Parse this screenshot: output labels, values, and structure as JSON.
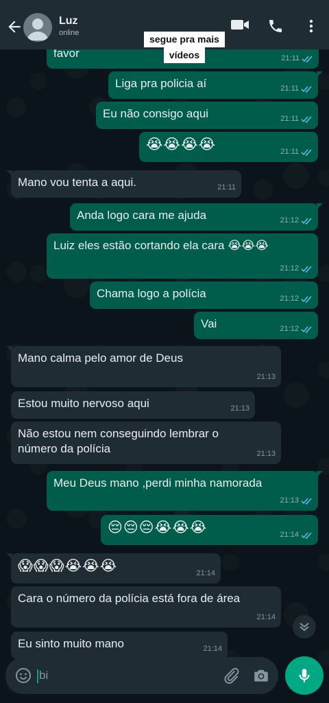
{
  "header": {
    "contact_name": "Luz",
    "contact_status": "online",
    "overlay_line1": "segue pra mais",
    "overlay_line2": "vídeos"
  },
  "messages": [
    {
      "dir": "out",
      "text": "favor",
      "time": "21:11",
      "read": true
    },
    {
      "dir": "out",
      "text": "Liga pra policia aí",
      "time": "21:11",
      "read": true
    },
    {
      "dir": "out",
      "text": "Eu não consigo aqui",
      "time": "21:11",
      "read": true
    },
    {
      "dir": "out",
      "text": "😭😭😭😭",
      "time": "21:11",
      "read": true
    },
    {
      "dir": "in",
      "text": "Mano vou tenta a aqui.",
      "time": "21:11"
    },
    {
      "dir": "out",
      "text": "Anda logo cara me ajuda",
      "time": "21:12",
      "read": true
    },
    {
      "dir": "out",
      "text": "Luiz eles estão cortando ela cara 😭😭😭",
      "time": "21:12",
      "read": true
    },
    {
      "dir": "out",
      "text": "Chama logo a polícia",
      "time": "21:12",
      "read": true
    },
    {
      "dir": "out",
      "text": "Vai",
      "time": "21:12",
      "read": true
    },
    {
      "dir": "in",
      "text": "Mano calma pelo amor de Deus",
      "time": "21:13"
    },
    {
      "dir": "in",
      "text": "Estou muito nervoso aqui",
      "time": "21:13"
    },
    {
      "dir": "in",
      "text": "Não estou nem conseguindo lembrar o número da polícia",
      "time": "21:13"
    },
    {
      "dir": "out",
      "text": "Meu Deus mano ,perdi minha namorada",
      "time": "21:13",
      "read": true
    },
    {
      "dir": "out",
      "text": "😔😔😔😭😭😭",
      "time": "21:14",
      "read": true
    },
    {
      "dir": "in",
      "text": "😱😱😱😭😭😭",
      "time": "21:14"
    },
    {
      "dir": "in",
      "text": "Cara o número da polícia está fora de área",
      "time": "21:14"
    },
    {
      "dir": "in",
      "text": "Eu sinto muito mano",
      "time": "21:14"
    }
  ],
  "composer": {
    "input_value": "bi"
  },
  "colors": {
    "outgoing_bubble": "#005c4b",
    "incoming_bubble": "#202c33",
    "accent": "#00a884",
    "read_ticks": "#53bdeb",
    "header_bg": "#1f2c34"
  },
  "icons": [
    "back-arrow-icon",
    "avatar-icon",
    "video-call-icon",
    "phone-icon",
    "more-options-icon",
    "double-check-icon",
    "scroll-down-icon",
    "emoji-icon",
    "attach-icon",
    "camera-icon",
    "mic-icon"
  ]
}
